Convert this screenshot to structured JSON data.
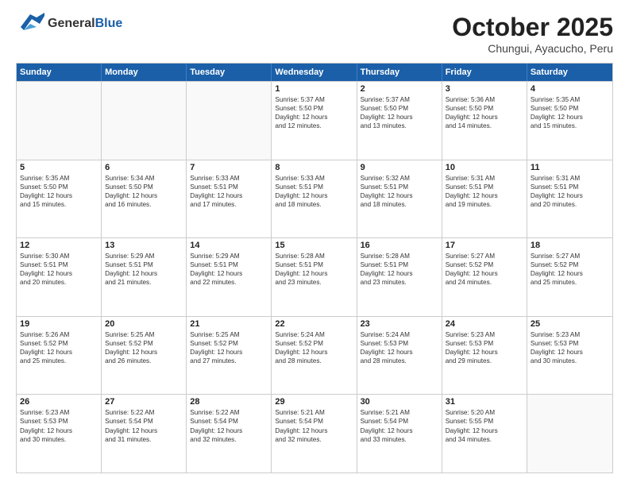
{
  "header": {
    "logo_general": "General",
    "logo_blue": "Blue",
    "month_title": "October 2025",
    "subtitle": "Chungui, Ayacucho, Peru"
  },
  "days_of_week": [
    "Sunday",
    "Monday",
    "Tuesday",
    "Wednesday",
    "Thursday",
    "Friday",
    "Saturday"
  ],
  "weeks": [
    [
      {
        "day": "",
        "info": "",
        "empty": true
      },
      {
        "day": "",
        "info": "",
        "empty": true
      },
      {
        "day": "",
        "info": "",
        "empty": true
      },
      {
        "day": "1",
        "info": "Sunrise: 5:37 AM\nSunset: 5:50 PM\nDaylight: 12 hours\nand 12 minutes."
      },
      {
        "day": "2",
        "info": "Sunrise: 5:37 AM\nSunset: 5:50 PM\nDaylight: 12 hours\nand 13 minutes."
      },
      {
        "day": "3",
        "info": "Sunrise: 5:36 AM\nSunset: 5:50 PM\nDaylight: 12 hours\nand 14 minutes."
      },
      {
        "day": "4",
        "info": "Sunrise: 5:35 AM\nSunset: 5:50 PM\nDaylight: 12 hours\nand 15 minutes."
      }
    ],
    [
      {
        "day": "5",
        "info": "Sunrise: 5:35 AM\nSunset: 5:50 PM\nDaylight: 12 hours\nand 15 minutes."
      },
      {
        "day": "6",
        "info": "Sunrise: 5:34 AM\nSunset: 5:50 PM\nDaylight: 12 hours\nand 16 minutes."
      },
      {
        "day": "7",
        "info": "Sunrise: 5:33 AM\nSunset: 5:51 PM\nDaylight: 12 hours\nand 17 minutes."
      },
      {
        "day": "8",
        "info": "Sunrise: 5:33 AM\nSunset: 5:51 PM\nDaylight: 12 hours\nand 18 minutes."
      },
      {
        "day": "9",
        "info": "Sunrise: 5:32 AM\nSunset: 5:51 PM\nDaylight: 12 hours\nand 18 minutes."
      },
      {
        "day": "10",
        "info": "Sunrise: 5:31 AM\nSunset: 5:51 PM\nDaylight: 12 hours\nand 19 minutes."
      },
      {
        "day": "11",
        "info": "Sunrise: 5:31 AM\nSunset: 5:51 PM\nDaylight: 12 hours\nand 20 minutes."
      }
    ],
    [
      {
        "day": "12",
        "info": "Sunrise: 5:30 AM\nSunset: 5:51 PM\nDaylight: 12 hours\nand 20 minutes."
      },
      {
        "day": "13",
        "info": "Sunrise: 5:29 AM\nSunset: 5:51 PM\nDaylight: 12 hours\nand 21 minutes."
      },
      {
        "day": "14",
        "info": "Sunrise: 5:29 AM\nSunset: 5:51 PM\nDaylight: 12 hours\nand 22 minutes."
      },
      {
        "day": "15",
        "info": "Sunrise: 5:28 AM\nSunset: 5:51 PM\nDaylight: 12 hours\nand 23 minutes."
      },
      {
        "day": "16",
        "info": "Sunrise: 5:28 AM\nSunset: 5:51 PM\nDaylight: 12 hours\nand 23 minutes."
      },
      {
        "day": "17",
        "info": "Sunrise: 5:27 AM\nSunset: 5:52 PM\nDaylight: 12 hours\nand 24 minutes."
      },
      {
        "day": "18",
        "info": "Sunrise: 5:27 AM\nSunset: 5:52 PM\nDaylight: 12 hours\nand 25 minutes."
      }
    ],
    [
      {
        "day": "19",
        "info": "Sunrise: 5:26 AM\nSunset: 5:52 PM\nDaylight: 12 hours\nand 25 minutes."
      },
      {
        "day": "20",
        "info": "Sunrise: 5:25 AM\nSunset: 5:52 PM\nDaylight: 12 hours\nand 26 minutes."
      },
      {
        "day": "21",
        "info": "Sunrise: 5:25 AM\nSunset: 5:52 PM\nDaylight: 12 hours\nand 27 minutes."
      },
      {
        "day": "22",
        "info": "Sunrise: 5:24 AM\nSunset: 5:52 PM\nDaylight: 12 hours\nand 28 minutes."
      },
      {
        "day": "23",
        "info": "Sunrise: 5:24 AM\nSunset: 5:53 PM\nDaylight: 12 hours\nand 28 minutes."
      },
      {
        "day": "24",
        "info": "Sunrise: 5:23 AM\nSunset: 5:53 PM\nDaylight: 12 hours\nand 29 minutes."
      },
      {
        "day": "25",
        "info": "Sunrise: 5:23 AM\nSunset: 5:53 PM\nDaylight: 12 hours\nand 30 minutes."
      }
    ],
    [
      {
        "day": "26",
        "info": "Sunrise: 5:23 AM\nSunset: 5:53 PM\nDaylight: 12 hours\nand 30 minutes."
      },
      {
        "day": "27",
        "info": "Sunrise: 5:22 AM\nSunset: 5:54 PM\nDaylight: 12 hours\nand 31 minutes."
      },
      {
        "day": "28",
        "info": "Sunrise: 5:22 AM\nSunset: 5:54 PM\nDaylight: 12 hours\nand 32 minutes."
      },
      {
        "day": "29",
        "info": "Sunrise: 5:21 AM\nSunset: 5:54 PM\nDaylight: 12 hours\nand 32 minutes."
      },
      {
        "day": "30",
        "info": "Sunrise: 5:21 AM\nSunset: 5:54 PM\nDaylight: 12 hours\nand 33 minutes."
      },
      {
        "day": "31",
        "info": "Sunrise: 5:20 AM\nSunset: 5:55 PM\nDaylight: 12 hours\nand 34 minutes."
      },
      {
        "day": "",
        "info": "",
        "empty": true
      }
    ]
  ]
}
